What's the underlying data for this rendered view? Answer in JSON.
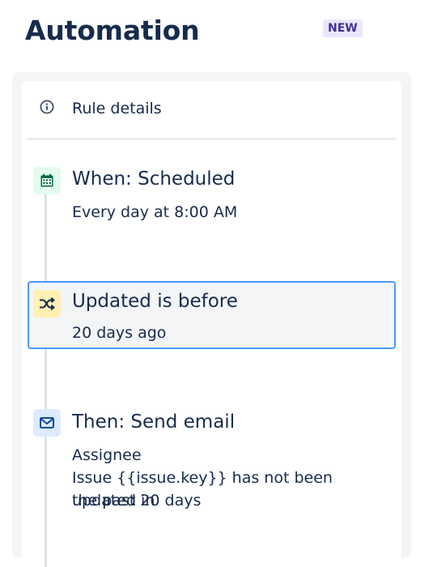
{
  "header": {
    "title": "Automation",
    "badge": "NEW"
  },
  "rule": {
    "details_label": "Rule details",
    "info_icon": "info-icon",
    "steps": [
      {
        "icon": "calendar-icon",
        "icon_bg": "#e3fcef",
        "icon_color": "#006644",
        "title": "When: Scheduled",
        "lines": [
          "Every day at 8:00 AM"
        ]
      },
      {
        "icon": "shuffle-icon",
        "icon_bg": "#fff0b3",
        "icon_color": "#172b4d",
        "title": "Updated is before",
        "lines": [
          "20 days ago"
        ],
        "selected": true
      },
      {
        "icon": "mail-icon",
        "icon_bg": "#deebff",
        "icon_color": "#0747a6",
        "title": "Then: Send email",
        "lines": [
          "Assignee",
          "Issue {{issue.key}} has not been updated in",
          "the past 20 days"
        ]
      }
    ]
  },
  "colors": {
    "accent": "#4c9aff",
    "text": "#172b4d",
    "badge_bg": "#eae6ff",
    "badge_text": "#403294"
  }
}
